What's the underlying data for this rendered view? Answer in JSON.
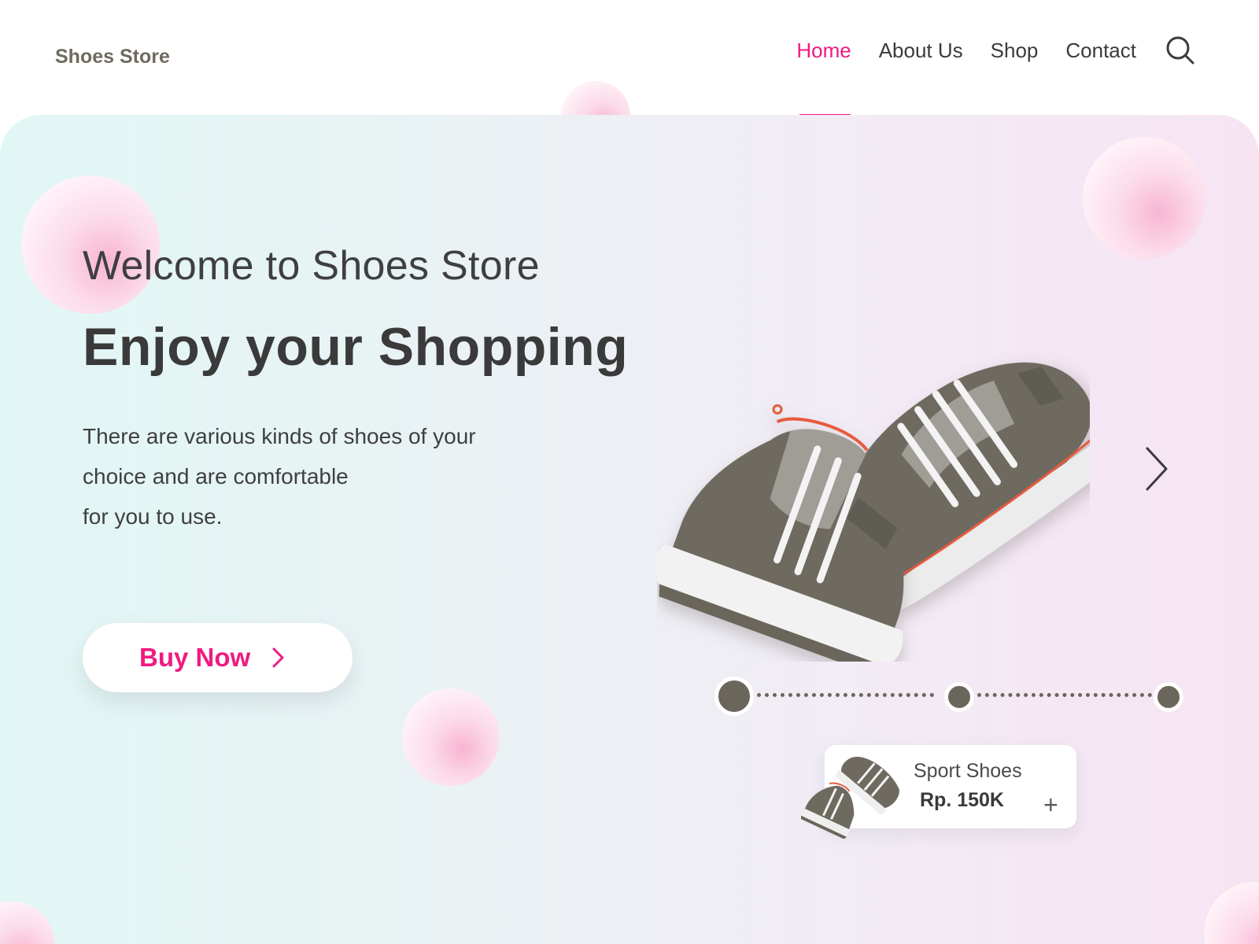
{
  "header": {
    "brand": "Shoes Store",
    "nav": [
      {
        "label": "Home",
        "active": true
      },
      {
        "label": "About Us",
        "active": false
      },
      {
        "label": "Shop",
        "active": false
      },
      {
        "label": "Contact",
        "active": false
      }
    ],
    "search_icon": "search-icon"
  },
  "hero": {
    "welcome": "Welcome to Shoes Store",
    "headline": "Enjoy your Shopping",
    "description_lines": [
      "There are various kinds of shoes of your",
      "choice and are comfortable",
      "for you to use."
    ],
    "cta_label": "Buy Now",
    "cta_icon": "chevron-right-icon",
    "next_icon": "chevron-right-icon"
  },
  "slider": {
    "slides": 3,
    "active_index": 0
  },
  "product_card": {
    "name": "Sport Shoes",
    "price": "Rp. 150K",
    "add_label": "+"
  },
  "colors": {
    "accent": "#f01a80",
    "text_dark": "#3a3a3a",
    "brand": "#6f6a5f",
    "dot": "#6b665c",
    "bubble": "#f8b5d2"
  }
}
